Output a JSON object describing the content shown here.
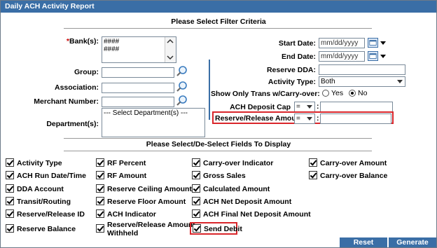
{
  "window": {
    "title": "Daily ACH Activity Report"
  },
  "filter": {
    "heading": "Please Select Filter Criteria",
    "bank_label": "*Bank(s):",
    "bank_items": [
      "####",
      "####"
    ],
    "group_label": "Group:",
    "association_label": "Association:",
    "merchant_label": "Merchant Number:",
    "department_label": "Department(s):",
    "department_placeholder": "--- Select Department(s) ---",
    "start_date_label": "Start Date:",
    "start_date_value": "mm/dd/yyyy",
    "end_date_label": "End Date:",
    "end_date_value": "mm/dd/yyyy",
    "reserve_dda_label": "Reserve DDA:",
    "activity_type_label": "Activity Type:",
    "activity_type_value": "Both",
    "carryover_label": "Show Only Trans w/Carry-over:",
    "carryover_yes": "Yes",
    "carryover_no": "No",
    "ach_deposit_cap_label": "ACH Deposit Cap",
    "ach_deposit_cap_op": "=",
    "reserve_release_label": "Reserve/Release Amount",
    "reserve_release_op": "=",
    "colon": ":"
  },
  "fields": {
    "heading": "Please Select/De-Select Fields To Display",
    "col1": [
      "Activity Type",
      "ACH Run Date/Time",
      "DDA Account",
      "Transit/Routing",
      "Reserve/Release ID",
      "Reserve Balance"
    ],
    "col2": [
      "RF Percent",
      "RF Amount",
      "Reserve Ceiling Amount",
      "Reserve Floor Amount",
      "ACH Indicator",
      "Reserve/Release Amount",
      "Withheld"
    ],
    "col3": [
      "Carry-over Indicator",
      "Gross Sales",
      "Calculated Amount",
      "ACH Net Deposit Amount",
      "ACH Final Net Deposit Amount",
      "Send Debit"
    ],
    "col4": [
      "Carry-over Amount",
      "Carry-over Balance"
    ]
  },
  "buttons": {
    "reset": "Reset",
    "generate": "Generate"
  },
  "colors": {
    "title_bar": "#3a6ea6",
    "highlight": "#d9262b"
  },
  "icons": [
    "search-icon",
    "calendar-icon",
    "chevron-down-icon",
    "checkbox-checked-icon"
  ]
}
